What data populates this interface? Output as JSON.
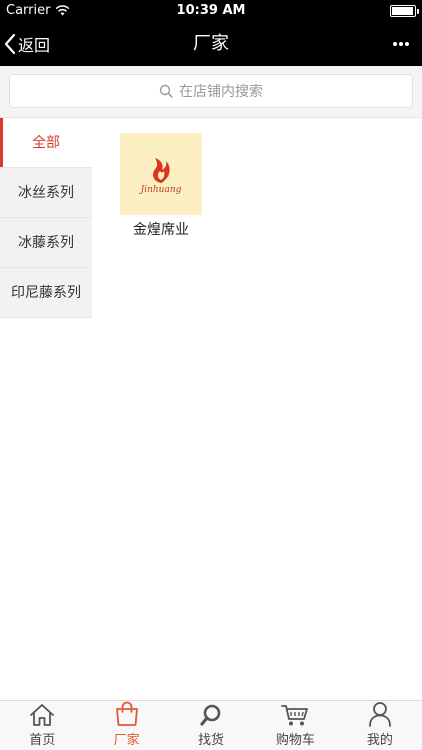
{
  "status_bar": {
    "carrier": "Carrier",
    "time": "10:39 AM"
  },
  "nav": {
    "back_label": "返回",
    "title": "厂家",
    "more_icon": "more-icon"
  },
  "search": {
    "placeholder": "在店铺内搜索",
    "icon": "search-icon"
  },
  "categories": [
    {
      "label": "全部",
      "active": true
    },
    {
      "label": "冰丝系列"
    },
    {
      "label": "冰藤系列"
    },
    {
      "label": "印尼藤系列"
    }
  ],
  "vendors": [
    {
      "name": "金煌席业",
      "logo_text": "Jinhuang"
    }
  ],
  "tabs": [
    {
      "label": "首页",
      "icon": "home-icon"
    },
    {
      "label": "厂家",
      "icon": "shopping-bag-icon",
      "active": true
    },
    {
      "label": "找货",
      "icon": "search-icon"
    },
    {
      "label": "购物车",
      "icon": "cart-icon"
    },
    {
      "label": "我的",
      "icon": "user-icon"
    }
  ],
  "colors": {
    "accent": "#d83a2f",
    "tab_active": "#e05a34",
    "nav_bg": "#000000",
    "sidebar_bg": "#f2f2f2"
  }
}
